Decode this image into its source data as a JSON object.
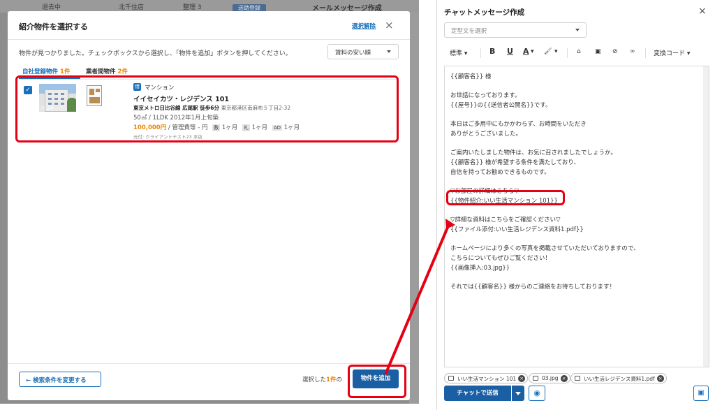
{
  "background": {
    "strip_items": [
      "退去中",
      "北千住店",
      "整理 3"
    ],
    "strip_badge": "送助登録",
    "panel_title": "メールメッセージ作成"
  },
  "modal": {
    "title": "紹介物件を選択する",
    "deselect_label": "選択解除",
    "close_icon": "×",
    "message": "物件が見つかりました。チェックボックスから選択し、「物件を追加」ボタンを押してください。",
    "sort_value": "賃料の安い順",
    "tabs": [
      {
        "label": "自社登録物件",
        "count": "1件"
      },
      {
        "label": "業者間物件",
        "count": "2件"
      }
    ],
    "property": {
      "photo_count": "◎ 24",
      "badge": "借",
      "type": "マンション",
      "name": "イイセイカツ・レジデンス 101",
      "access": "東京メトロ日比谷線 広尾駅 徒歩6分",
      "address": "東京都港区南麻布５丁目2-32",
      "spec": "50㎡ / 1LDK  2012年1月上旬築",
      "price": "100,000円",
      "fee": "/ 管理費等 - 円",
      "deposit_tag": "敷",
      "deposit": "1ヶ月",
      "key_money_tag": "礼",
      "key_money": "1ヶ月",
      "ad_tag": "AD",
      "ad": "1ヶ月",
      "source": "元付: クライアントテスト23 本店"
    },
    "back_button": "← 検索条件を変更する",
    "selected_prefix": "選択した",
    "selected_count": "1件",
    "selected_suffix": "の",
    "add_button": "物件を追加"
  },
  "composer": {
    "title": "チャットメッセージ作成",
    "close_icon": "×",
    "template_placeholder": "定型文を選択",
    "toolbar": {
      "style": "標準",
      "bold": "B",
      "underline": "U",
      "color": "A",
      "highlight": "🖌",
      "convert_code": "変換コード"
    },
    "body_lines": [
      "{{顧客名}} 様",
      "",
      "お世話になっております。",
      "{{屋号}}の{{送信者公開名}}です。",
      "",
      "本日はご多用中にもかかわらず、お時間をいただき",
      "ありがとうございました。",
      "",
      "ご案内いたしました物件は、お気に召されましたでしょうか。",
      "{{顧客名}} 様が希望する条件を満たしており、",
      "自信を持ってお勧めできるものです。",
      "",
      "▽お部屋の詳細はこちら▽",
      "{{物件紹介:いい生活マンション 101}}",
      "",
      "▽詳細な資料はこちらをご確認ください▽",
      "{{ファイル添付:いい生活レジデンス資料1.pdf}}",
      "",
      "ホームページにより多くの写真を掲載させていただいておりますので、",
      "こちらについてもぜひご覧ください！",
      "{{画像挿入:03.jpg}}",
      "",
      "それでは{{顧客名}} 様からのご連絡をお待ちしております！"
    ],
    "attachments": [
      "いい生活マンション 101",
      "03.jpg",
      "いい生活レジデンス資料1.pdf"
    ],
    "send_button": "チャットで送信",
    "preview_icon": "◉",
    "save_icon": "▣"
  },
  "colors": {
    "accent": "#1a6fb8",
    "primary_button": "#1a5fa3",
    "highlight_red": "#e50012",
    "count_orange": "#e8870d"
  }
}
